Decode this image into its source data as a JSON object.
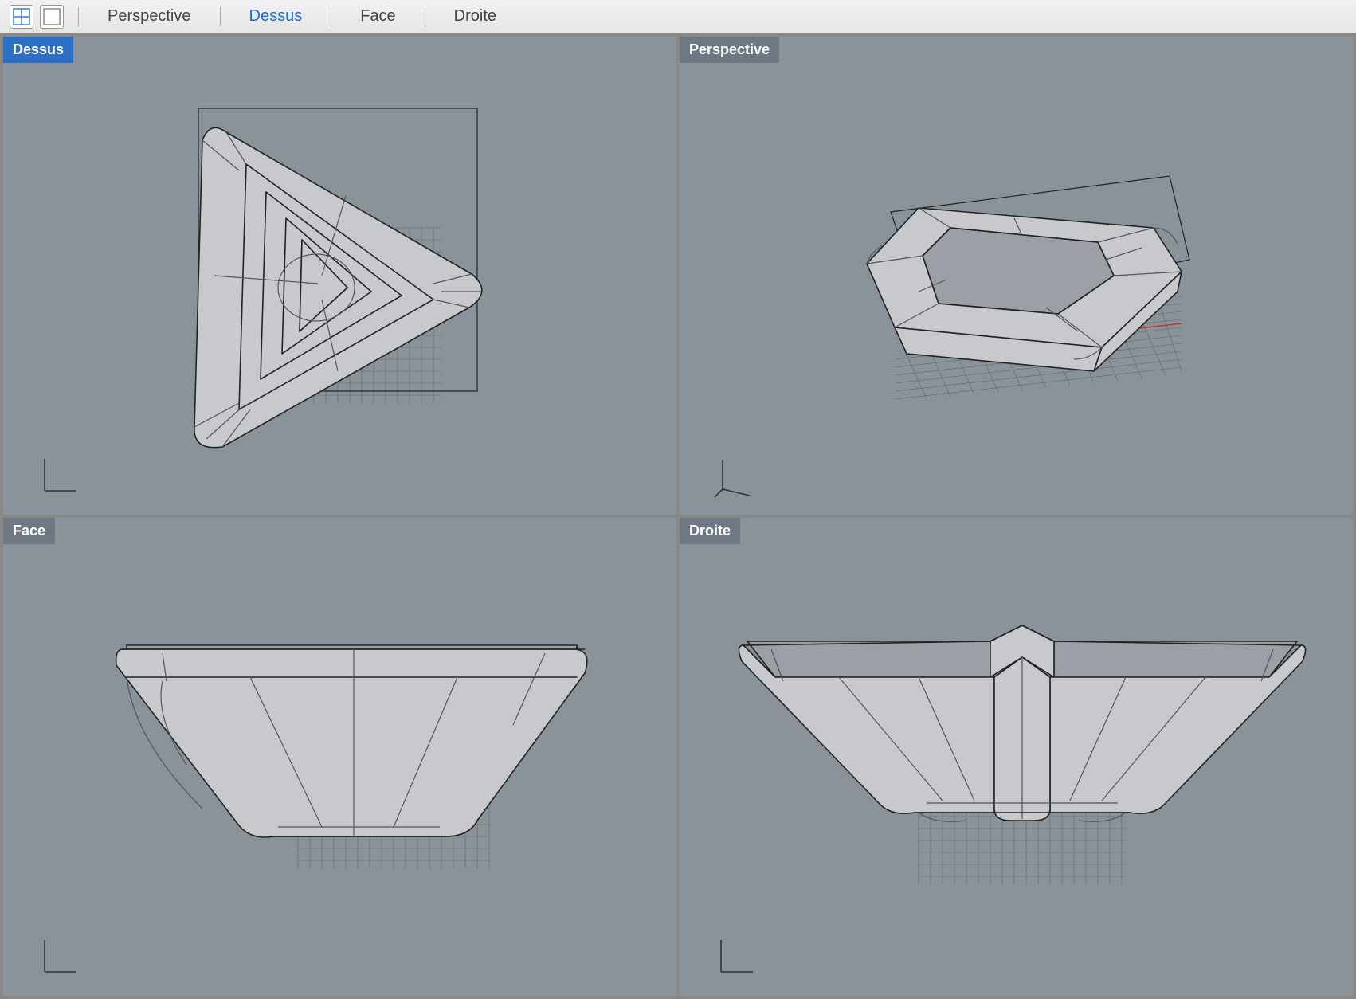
{
  "toolbar": {
    "tabs": {
      "perspective": "Perspective",
      "top": "Dessus",
      "front": "Face",
      "right": "Droite"
    },
    "active_tab": "top"
  },
  "viewports": {
    "top_left": {
      "label": "Dessus",
      "active": true
    },
    "top_right": {
      "label": "Perspective",
      "active": false
    },
    "bottom_left": {
      "label": "Face",
      "active": false
    },
    "bottom_right": {
      "label": "Droite",
      "active": false
    }
  }
}
